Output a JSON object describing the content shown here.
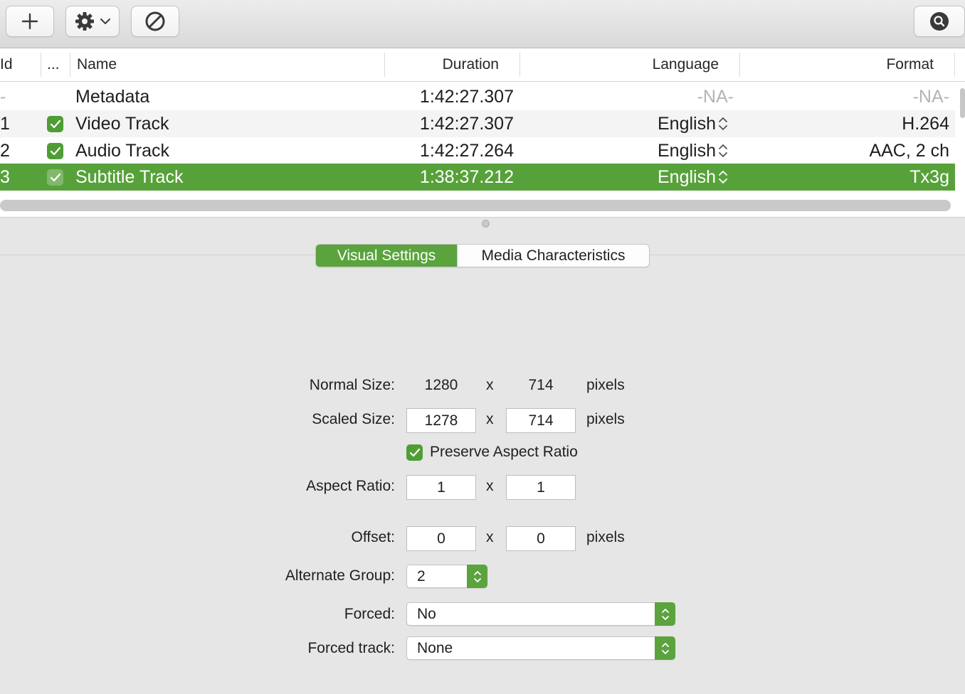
{
  "toolbar": {
    "add_icon": "plus-icon",
    "action_icon": "gear-icon",
    "remove_icon": "prohibited-icon",
    "search_icon": "search-icon"
  },
  "table": {
    "columns": [
      "Id",
      "...",
      "Name",
      "Duration",
      "Language",
      "Format"
    ],
    "rows": [
      {
        "id": "-",
        "enabled": false,
        "name": "Metadata",
        "duration": "1:42:27.307",
        "language": "-NA-",
        "format": "-NA-"
      },
      {
        "id": "1",
        "enabled": true,
        "name": "Video Track",
        "duration": "1:42:27.307",
        "language": "English",
        "format": "H.264"
      },
      {
        "id": "2",
        "enabled": true,
        "name": "Audio Track",
        "duration": "1:42:27.264",
        "language": "English",
        "format": "AAC, 2 ch"
      },
      {
        "id": "3",
        "enabled": true,
        "name": "Subtitle Track",
        "duration": "1:38:37.212",
        "language": "English",
        "format": "Tx3g"
      }
    ],
    "selected_row": 3
  },
  "tabs": {
    "active": "Visual Settings",
    "inactive": "Media Characteristics"
  },
  "form": {
    "normal_size_label": "Normal Size:",
    "normal_width": "1280",
    "normal_height": "714",
    "scaled_size_label": "Scaled Size:",
    "scaled_width": "1278",
    "scaled_height": "714",
    "preserve_label": "Preserve Aspect Ratio",
    "preserve_checked": true,
    "aspect_label": "Aspect Ratio:",
    "aspect_w": "1",
    "aspect_h": "1",
    "offset_label": "Offset:",
    "offset_x": "0",
    "offset_y": "0",
    "alternate_label": "Alternate Group:",
    "alternate_value": "2",
    "forced_label": "Forced:",
    "forced_value": "No",
    "forced_track_label": "Forced track:",
    "forced_track_value": "None",
    "x": "x",
    "pixels": "pixels"
  },
  "colors": {
    "accent": "#5aa33d",
    "selection": "#57a13b"
  }
}
